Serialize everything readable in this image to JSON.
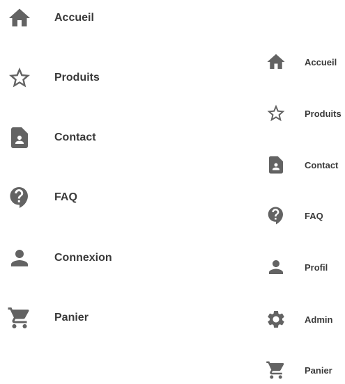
{
  "menu_left": {
    "items": [
      {
        "label": "Accueil",
        "icon": "home-icon"
      },
      {
        "label": "Produits",
        "icon": "star-outline-icon"
      },
      {
        "label": "Contact",
        "icon": "contact-card-icon"
      },
      {
        "label": "FAQ",
        "icon": "help-icon"
      },
      {
        "label": "Connexion",
        "icon": "person-icon"
      },
      {
        "label": "Panier",
        "icon": "cart-icon"
      }
    ]
  },
  "menu_right": {
    "items": [
      {
        "label": "Accueil",
        "icon": "home-icon"
      },
      {
        "label": "Produits",
        "icon": "star-outline-icon"
      },
      {
        "label": "Contact",
        "icon": "contact-card-icon"
      },
      {
        "label": "FAQ",
        "icon": "help-icon"
      },
      {
        "label": "Profil",
        "icon": "person-icon"
      },
      {
        "label": "Admin",
        "icon": "gear-icon"
      },
      {
        "label": "Panier",
        "icon": "cart-icon"
      }
    ]
  },
  "colors": {
    "icon": "#636363",
    "text": "#3a3a3a",
    "background": "#ffffff"
  }
}
